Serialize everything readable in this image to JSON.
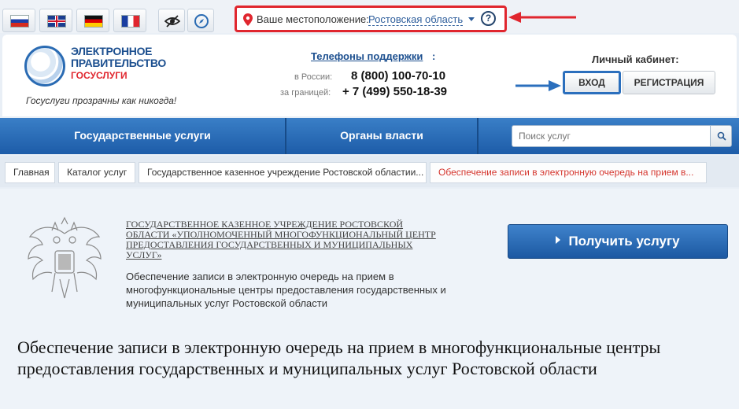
{
  "languages": [
    {
      "name": "flag-ru-icon",
      "label": "Русский"
    },
    {
      "name": "flag-uk-icon",
      "label": "English"
    },
    {
      "name": "flag-de-icon",
      "label": "Deutsch"
    },
    {
      "name": "flag-fr-icon",
      "label": "Français"
    }
  ],
  "tools": [
    "eye-icon",
    "compass-icon"
  ],
  "location": {
    "label": "Ваше местоположение:",
    "value": "Ростовская область",
    "help": "?"
  },
  "logo": {
    "line1": "ЭЛЕКТРОННОЕ",
    "line2": "ПРАВИТЕЛЬСТВО",
    "line3": "ГОСУСЛУГИ",
    "slogan": "Госуслуги прозрачны как никогда!"
  },
  "support": {
    "title": "Телефоны поддержки",
    "colon": ":",
    "russia_label": "в России:",
    "russia_number": "8 (800) 100-70-10",
    "abroad_label": "за границей:",
    "abroad_number": "+ 7 (499) 550-18-39"
  },
  "cabinet": {
    "title": "Личный кабинет:",
    "login": "ВХОД",
    "register": "РЕГИСТРАЦИЯ"
  },
  "nav": {
    "items": [
      "Государственные услуги",
      "Органы власти"
    ],
    "search_placeholder": "Поиск услуг"
  },
  "breadcrumbs": [
    "Главная",
    "Каталог услуг",
    "Государственное казенное учреждение Ростовской областии...",
    "Обеспечение записи в электронную очередь на прием в..."
  ],
  "service": {
    "org": "ГОСУДАРСТВЕННОЕ КАЗЕННОЕ УЧРЕЖДЕНИЕ РОСТОВСКОЙ ОБЛАСТИ «УПОЛНОМОЧЕННЫЙ МНОГОФУНКЦИОНАЛЬНЫЙ ЦЕНТР ПРЕДОСТАВЛЕНИЯ ГОСУДАРСТВЕННЫХ И МУНИЦИПАЛЬНЫХ УСЛУГ»",
    "short": "Обеспечение записи в электронную очередь на прием в многофункциональные центры предоставления государственных и муниципальных услуг Ростовской области",
    "get_button": "Получить услугу",
    "title": "Обеспечение записи в электронную очередь на прием в многофункциональные центры предоставления государственных и муниципальных услуг Ростовской области"
  },
  "colors": {
    "accent_blue": "#1d5ca8",
    "highlight_red": "#e0262e",
    "active_crumb": "#d5362e"
  }
}
